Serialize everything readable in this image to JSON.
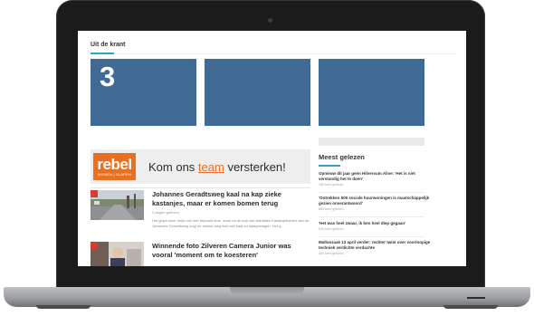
{
  "section": {
    "title": "Uit de krant"
  },
  "tiles": [
    {
      "number": "3"
    },
    {
      "number": ""
    },
    {
      "number": ""
    }
  ],
  "ad": {
    "brand": "rebel",
    "brand_sub": "WONEN | SLAPEN",
    "tagline_before": "Kom ons ",
    "tagline_accent": "team",
    "tagline_after": " versterken!",
    "brand_color": "#ea6f21"
  },
  "articles": [
    {
      "title": "Johannes Geradtsweg kaal na kap zieke kastanjes, maar er komen bomen terug",
      "meta": "3 dagen geleden",
      "snippet": "Het grijze weer helpt ook niet bepaald mee, maar na de kap van twintallen Kastanjebomen aan de Johannes Geradtsweg oogt de drukke weg toch wel kaal en kaalgeslagen. Het g..."
    },
    {
      "title": "Winnende foto Zilveren Camera Junior was vooral 'moment om te koesteren'",
      "meta": "",
      "snippet": ""
    }
  ],
  "sidebar": {
    "title": "Meest gelezen",
    "items": [
      {
        "headline": "Opnieuw dit jaar geen Hilversum Alive: 'Het is niet verstandig het te doen'",
        "meta": "766 keer gelezen"
      },
      {
        "headline": "'Ontrekken 509 sociale huurwoningen is maatschappelijk gezien onverantwoord'",
        "meta": "683 keer gelezen"
      },
      {
        "headline": "'Het was heel zwaar, ik ben heel diep gegaan'",
        "meta": "630 keer gelezen"
      },
      {
        "headline": "Mallonzaak 13 april verder: rechter twist over voorloopige techniek verdichte verdachte",
        "meta": "480 keer gelezen"
      }
    ]
  },
  "colors": {
    "accent": "#2aa7c7",
    "tile": "#3e6a93",
    "badge": "#d63c2f"
  }
}
